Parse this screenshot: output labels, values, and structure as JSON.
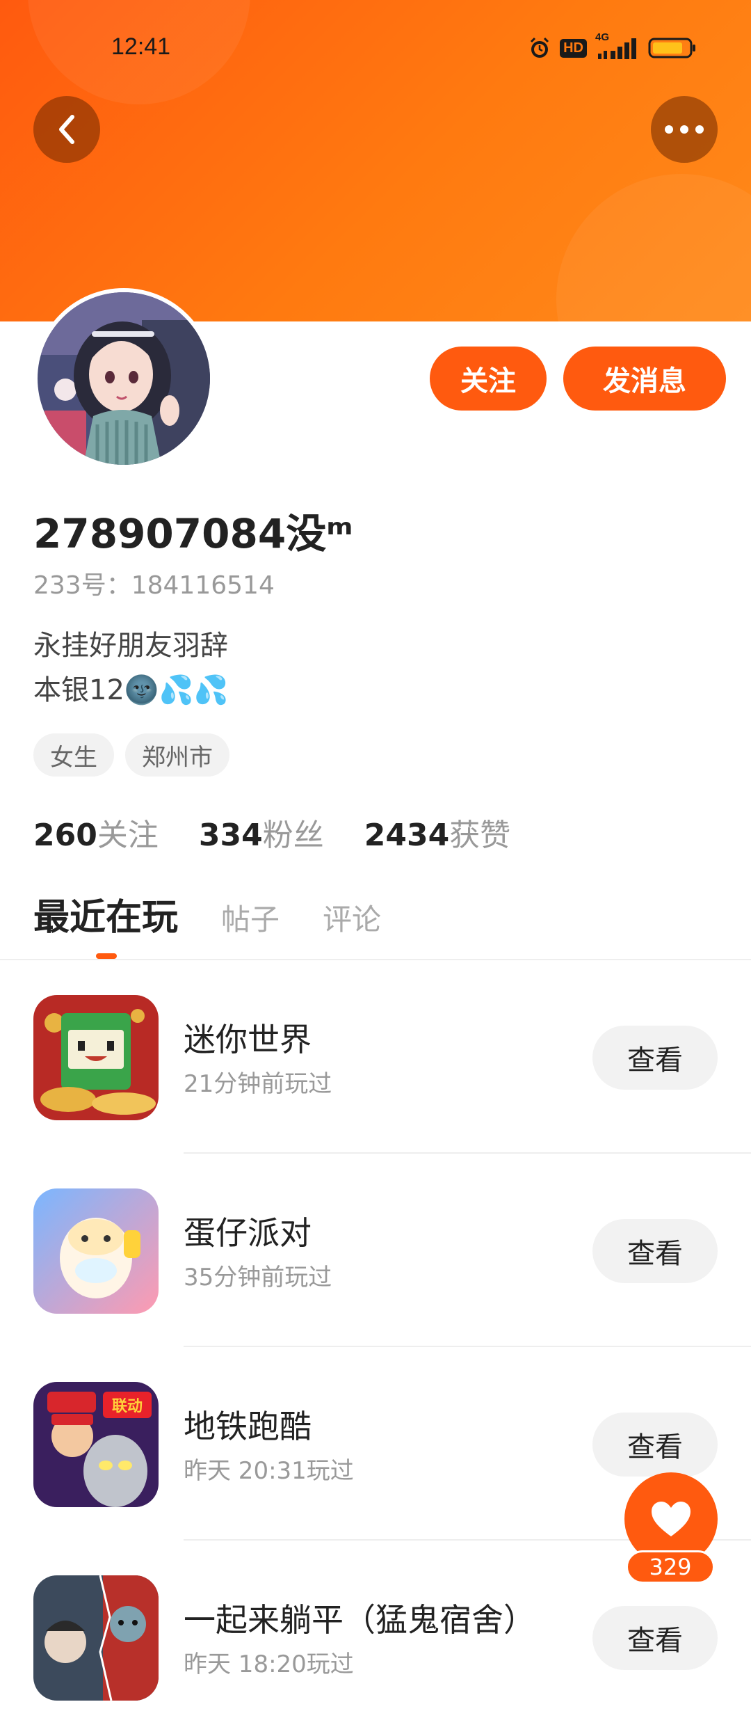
{
  "status_bar": {
    "time": "12:41",
    "hd_label": "HD",
    "network_label": "4G"
  },
  "profile": {
    "username": "278907084没ᵐ",
    "id_line": "233号：184116514",
    "bio_line1": "永挂好朋友羽辞",
    "bio_line2": "本银12🌚💦💦",
    "tags": [
      "女生",
      "郑州市"
    ]
  },
  "actions": {
    "follow_label": "关注",
    "message_label": "发消息"
  },
  "stats": [
    {
      "value": "260",
      "label": "关注"
    },
    {
      "value": "334",
      "label": "粉丝"
    },
    {
      "value": "2434",
      "label": "获赞"
    }
  ],
  "tabs": [
    {
      "label": "最近在玩",
      "active": true
    },
    {
      "label": "帖子",
      "active": false
    },
    {
      "label": "评论",
      "active": false
    }
  ],
  "games": [
    {
      "name": "迷你世界",
      "time": "21分钟前玩过",
      "button": "查看"
    },
    {
      "name": "蛋仔派对",
      "time": "35分钟前玩过",
      "button": "查看"
    },
    {
      "name": "地铁跑酷",
      "time": "昨天 20:31玩过",
      "button": "查看"
    },
    {
      "name": "一起来躺平（猛鬼宿舍）",
      "time": "昨天 18:20玩过",
      "button": "查看"
    }
  ],
  "like_fab": {
    "count": "329"
  },
  "colors": {
    "accent": "#ff5a0f",
    "header_start": "#ff5a0f",
    "header_end": "#ff8a1a"
  },
  "icons": [
    "back-icon",
    "more-icon",
    "alarm-icon",
    "signal-icon",
    "battery-icon",
    "heart-icon"
  ]
}
